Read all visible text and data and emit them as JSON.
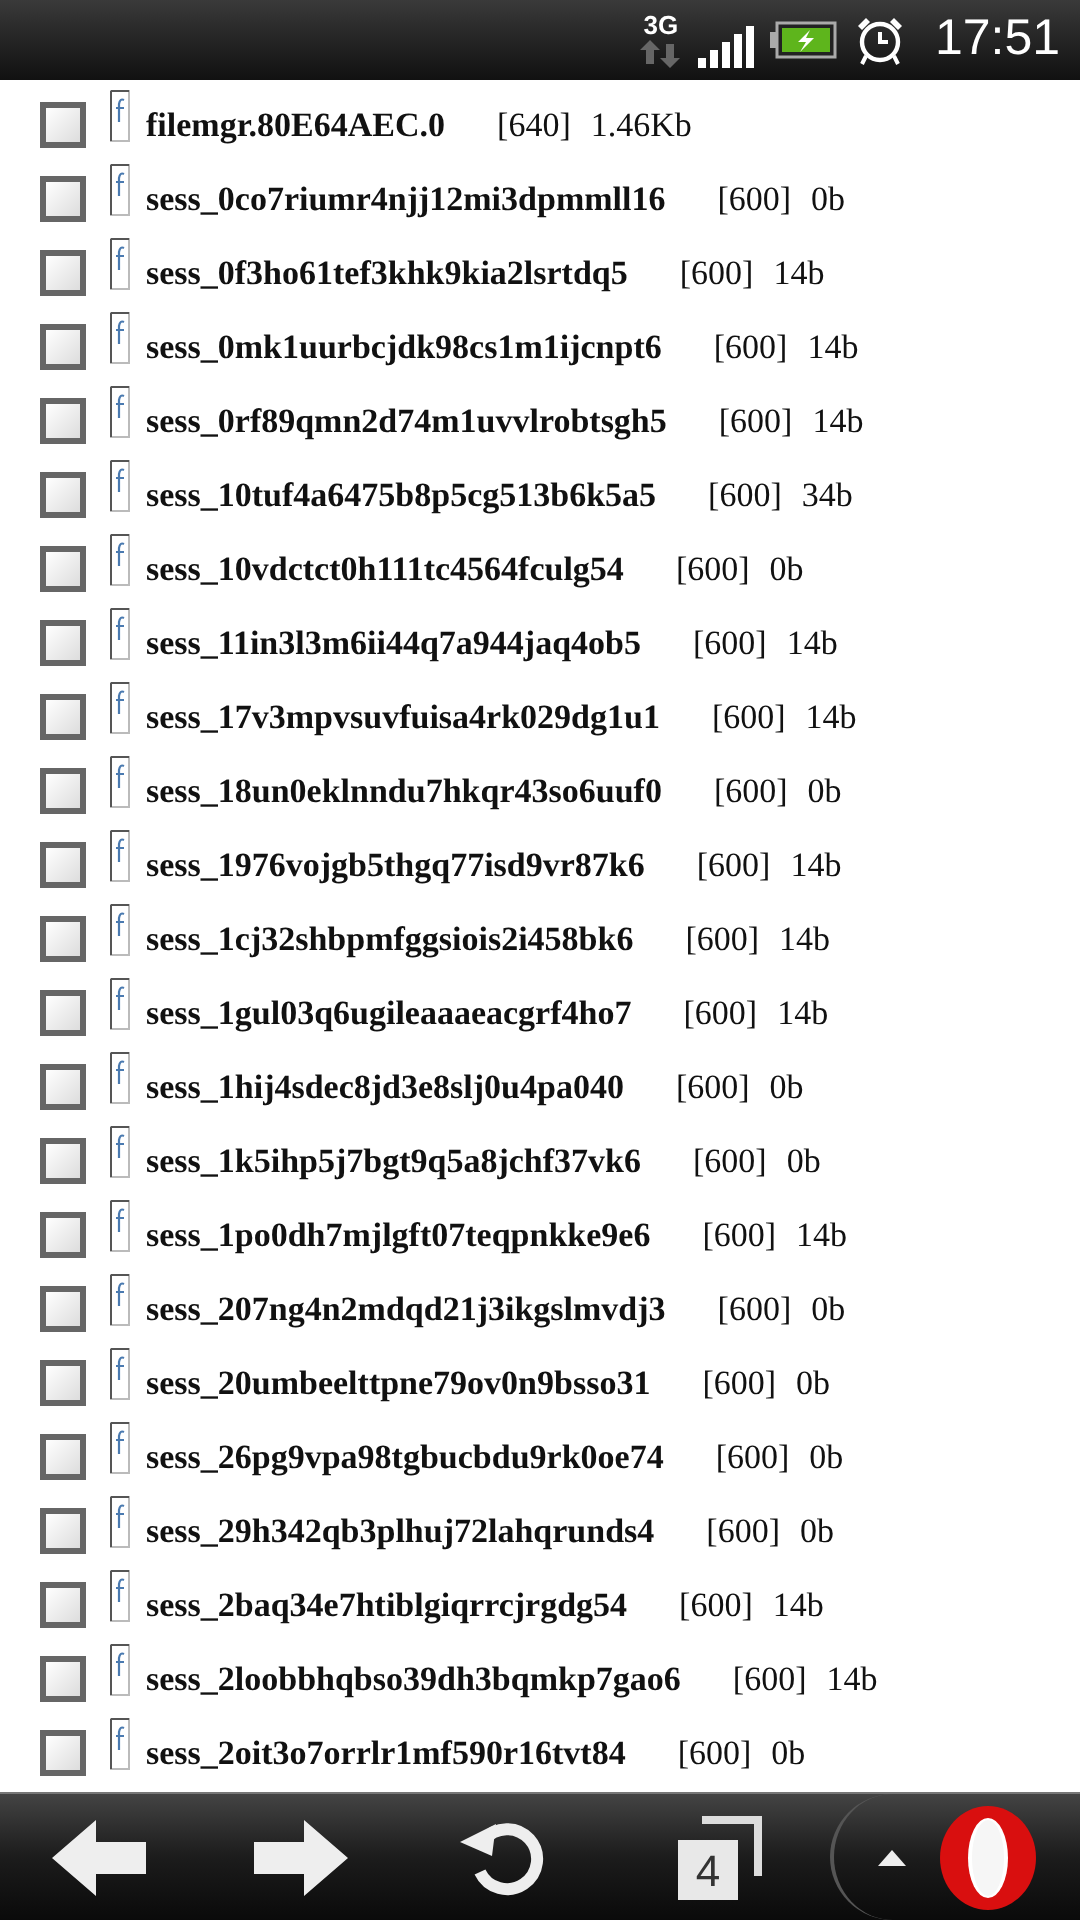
{
  "status_bar": {
    "network": "3G",
    "time": "17:51"
  },
  "files": [
    {
      "name": "filemgr.80E64AEC.0",
      "permissions": "[640]",
      "size": "1.46Kb",
      "checked": false
    },
    {
      "name": "sess_0co7riumr4njj12mi3dpmmll16",
      "permissions": "[600]",
      "size": "0b",
      "checked": false
    },
    {
      "name": "sess_0f3ho61tef3khk9kia2lsrtdq5",
      "permissions": "[600]",
      "size": "14b",
      "checked": false
    },
    {
      "name": "sess_0mk1uurbcjdk98cs1m1ijcnpt6",
      "permissions": "[600]",
      "size": "14b",
      "checked": false
    },
    {
      "name": "sess_0rf89qmn2d74m1uvvlrobtsgh5",
      "permissions": "[600]",
      "size": "14b",
      "checked": false
    },
    {
      "name": "sess_10tuf4a6475b8p5cg513b6k5a5",
      "permissions": "[600]",
      "size": "34b",
      "checked": false
    },
    {
      "name": "sess_10vdctct0h111tc4564fculg54",
      "permissions": "[600]",
      "size": "0b",
      "checked": false
    },
    {
      "name": "sess_11in3l3m6ii44q7a944jaq4ob5",
      "permissions": "[600]",
      "size": "14b",
      "checked": false
    },
    {
      "name": "sess_17v3mpvsuvfuisa4rk029dg1u1",
      "permissions": "[600]",
      "size": "14b",
      "checked": false
    },
    {
      "name": "sess_18un0eklnndu7hkqr43so6uuf0",
      "permissions": "[600]",
      "size": "0b",
      "checked": false
    },
    {
      "name": "sess_1976vojgb5thgq77isd9vr87k6",
      "permissions": "[600]",
      "size": "14b",
      "checked": false
    },
    {
      "name": "sess_1cj32shbpmfggsiois2i458bk6",
      "permissions": "[600]",
      "size": "14b",
      "checked": false
    },
    {
      "name": "sess_1gul03q6ugileaaaeacgrf4ho7",
      "permissions": "[600]",
      "size": "14b",
      "checked": false
    },
    {
      "name": "sess_1hij4sdec8jd3e8slj0u4pa040",
      "permissions": "[600]",
      "size": "0b",
      "checked": false
    },
    {
      "name": "sess_1k5ihp5j7bgt9q5a8jchf37vk6",
      "permissions": "[600]",
      "size": "0b",
      "checked": false
    },
    {
      "name": "sess_1po0dh7mjlgft07teqpnkke9e6",
      "permissions": "[600]",
      "size": "14b",
      "checked": false
    },
    {
      "name": "sess_207ng4n2mdqd21j3ikgslmvdj3",
      "permissions": "[600]",
      "size": "0b",
      "checked": false
    },
    {
      "name": "sess_20umbeelttpne79ov0n9bsso31",
      "permissions": "[600]",
      "size": "0b",
      "checked": false
    },
    {
      "name": "sess_26pg9vpa98tgbucbdu9rk0oe74",
      "permissions": "[600]",
      "size": "0b",
      "checked": false
    },
    {
      "name": "sess_29h342qb3plhuj72lahqrunds4",
      "permissions": "[600]",
      "size": "0b",
      "checked": false
    },
    {
      "name": "sess_2baq34e7htiblgiqrrcjrgdg54",
      "permissions": "[600]",
      "size": "14b",
      "checked": false
    },
    {
      "name": "sess_2loobbhqbso39dh3bqmkp7gao6",
      "permissions": "[600]",
      "size": "14b",
      "checked": false
    },
    {
      "name": "sess_2oit3o7orrlr1mf590r16tvt84",
      "permissions": "[600]",
      "size": "0b",
      "checked": false
    }
  ],
  "toolbar": {
    "tab_count": "4"
  }
}
